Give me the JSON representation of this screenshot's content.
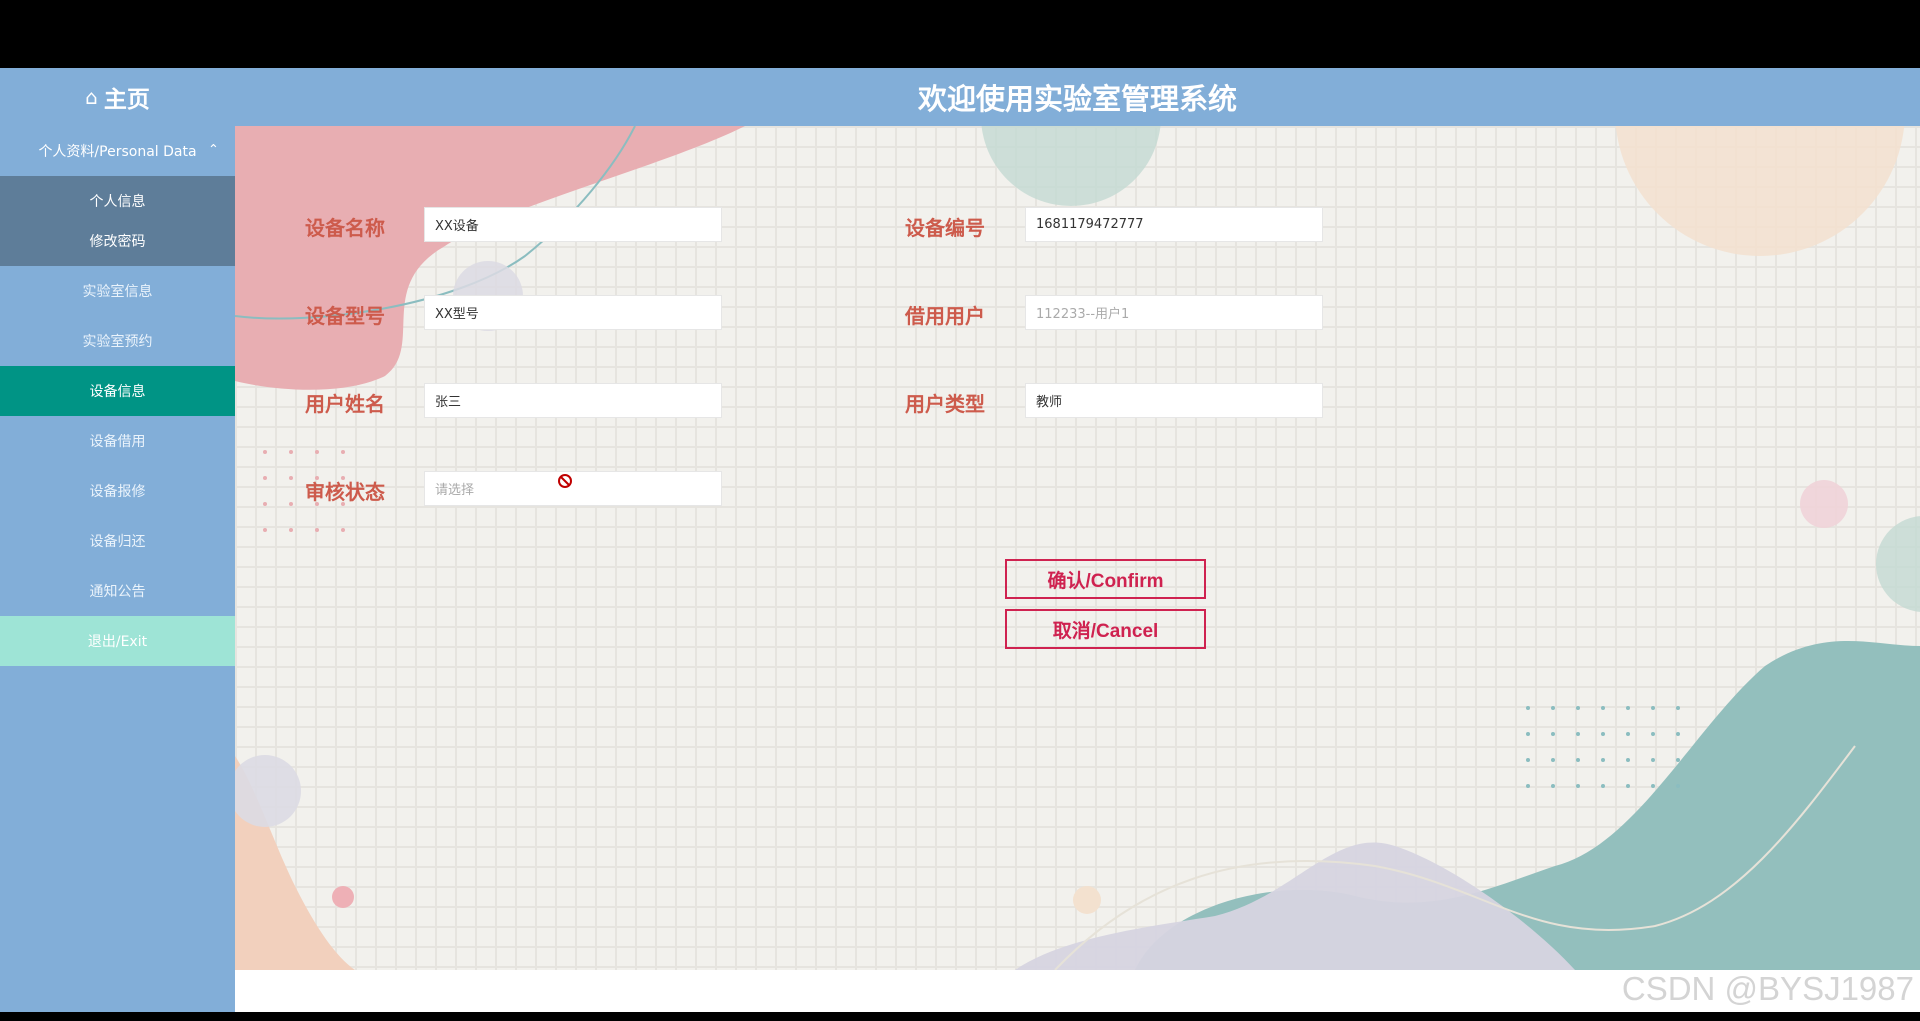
{
  "header": {
    "home_label": "主页",
    "home_icon": "home-icon",
    "title": "欢迎使用实验室管理系统"
  },
  "sidebar": {
    "group": {
      "label": "个人资料/Personal Data",
      "expanded": true
    },
    "subitems": [
      {
        "label": "个人信息"
      },
      {
        "label": "修改密码"
      }
    ],
    "items": [
      {
        "label": "实验室信息"
      },
      {
        "label": "实验室预约"
      },
      {
        "label": "设备信息",
        "active": true
      },
      {
        "label": "设备借用"
      },
      {
        "label": "设备报修"
      },
      {
        "label": "设备归还"
      },
      {
        "label": "通知公告"
      },
      {
        "label": "退出/Exit"
      }
    ]
  },
  "form": {
    "device_name": {
      "label": "设备名称",
      "value": "XX设备"
    },
    "device_no": {
      "label": "设备编号",
      "value": "1681179472777"
    },
    "device_model": {
      "label": "设备型号",
      "value": "XX型号"
    },
    "borrow_user": {
      "label": "借用用户",
      "placeholder": "112233--用户1"
    },
    "user_name": {
      "label": "用户姓名",
      "value": "张三"
    },
    "user_type": {
      "label": "用户类型",
      "value": "教师"
    },
    "audit_status": {
      "label": "审核状态",
      "placeholder": "请选择"
    }
  },
  "buttons": {
    "confirm": "确认/Confirm",
    "cancel": "取消/Cancel"
  },
  "colors": {
    "sidebar": "#82aed8",
    "active_item": "#009485",
    "exit_item": "#9ee4d6",
    "label": "#cd5b4c",
    "button": "#cf2250"
  },
  "watermark": "CSDN @BYSJ1987"
}
